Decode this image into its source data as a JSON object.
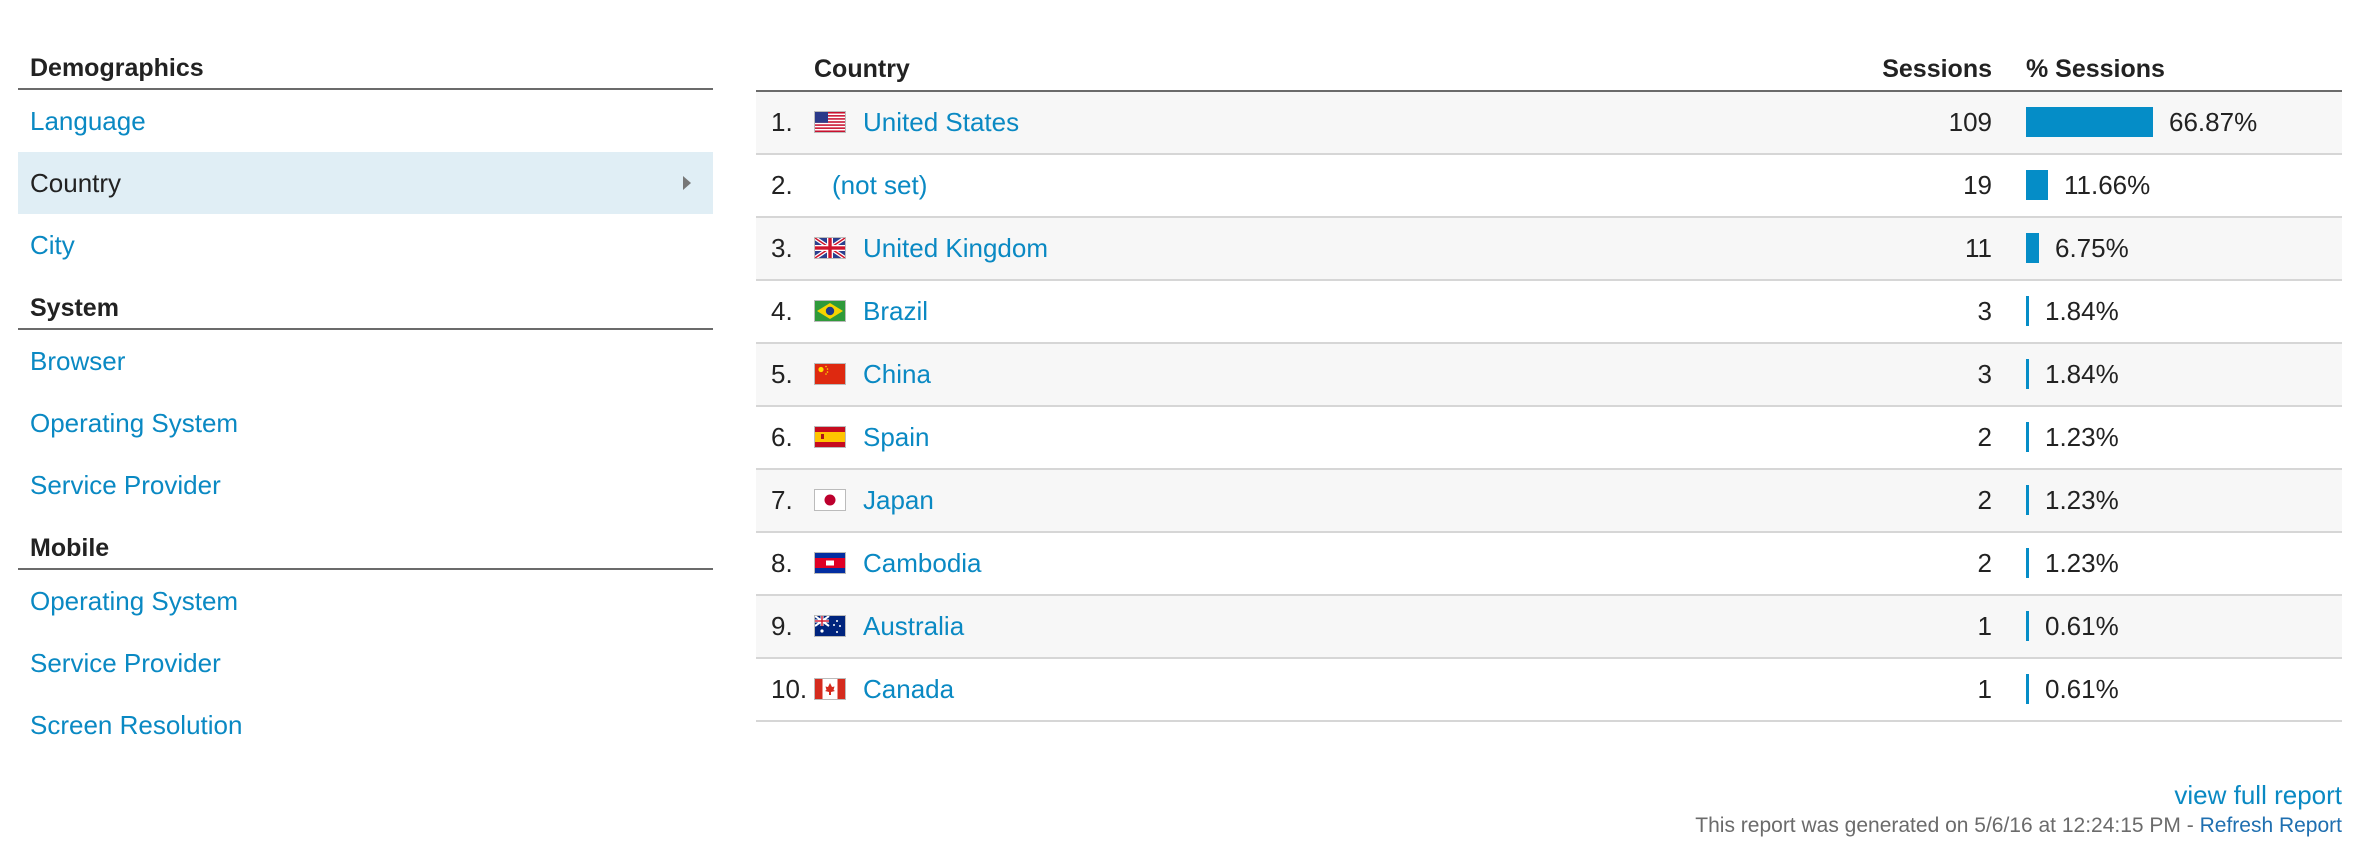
{
  "sidebar": {
    "sections": [
      {
        "title": "Demographics",
        "items": [
          {
            "label": "Language",
            "active": false
          },
          {
            "label": "Country",
            "active": true
          },
          {
            "label": "City",
            "active": false
          }
        ]
      },
      {
        "title": "System",
        "items": [
          {
            "label": "Browser",
            "active": false
          },
          {
            "label": "Operating System",
            "active": false
          },
          {
            "label": "Service Provider",
            "active": false
          }
        ]
      },
      {
        "title": "Mobile",
        "items": [
          {
            "label": "Operating System",
            "active": false
          },
          {
            "label": "Service Provider",
            "active": false
          },
          {
            "label": "Screen Resolution",
            "active": false
          }
        ]
      }
    ]
  },
  "table": {
    "headers": {
      "country": "Country",
      "sessions": "Sessions",
      "pct_sessions": "% Sessions"
    },
    "rows": [
      {
        "rank": "1.",
        "flag": "us",
        "country": "United States",
        "sessions": "109",
        "pct": "66.87%",
        "share": 0.6687
      },
      {
        "rank": "2.",
        "flag": "",
        "country": "(not set)",
        "sessions": "19",
        "pct": "11.66%",
        "share": 0.1166
      },
      {
        "rank": "3.",
        "flag": "gb",
        "country": "United Kingdom",
        "sessions": "11",
        "pct": "6.75%",
        "share": 0.0675
      },
      {
        "rank": "4.",
        "flag": "br",
        "country": "Brazil",
        "sessions": "3",
        "pct": "1.84%",
        "share": 0.0184
      },
      {
        "rank": "5.",
        "flag": "cn",
        "country": "China",
        "sessions": "3",
        "pct": "1.84%",
        "share": 0.0184
      },
      {
        "rank": "6.",
        "flag": "es",
        "country": "Spain",
        "sessions": "2",
        "pct": "1.23%",
        "share": 0.0123
      },
      {
        "rank": "7.",
        "flag": "jp",
        "country": "Japan",
        "sessions": "2",
        "pct": "1.23%",
        "share": 0.0123
      },
      {
        "rank": "8.",
        "flag": "kh",
        "country": "Cambodia",
        "sessions": "2",
        "pct": "1.23%",
        "share": 0.0123
      },
      {
        "rank": "9.",
        "flag": "au",
        "country": "Australia",
        "sessions": "1",
        "pct": "0.61%",
        "share": 0.0061
      },
      {
        "rank": "10.",
        "flag": "ca",
        "country": "Canada",
        "sessions": "1",
        "pct": "0.61%",
        "share": 0.0061
      }
    ],
    "view_full_report": "view full report"
  },
  "footer": {
    "generated_text": "This report was generated on 5/6/16 at 12:24:15 PM - ",
    "refresh_label": "Refresh Report"
  },
  "colors": {
    "link": "#0a89c3",
    "bar": "#058dc7",
    "active_bg": "#e0eef5"
  }
}
